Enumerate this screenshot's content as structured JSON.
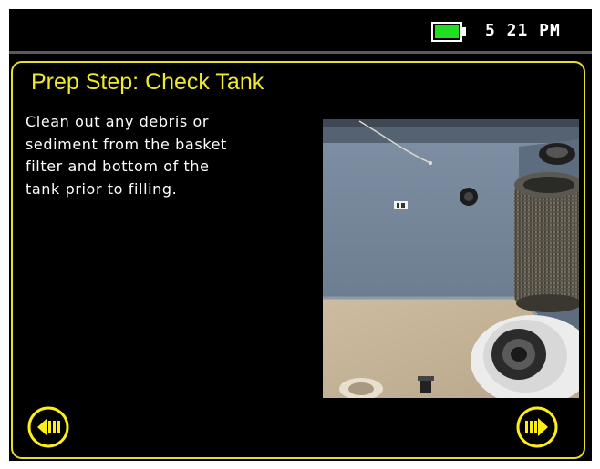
{
  "status": {
    "battery_color": "#22dd22",
    "battery_icon": "battery-icon",
    "time": "5 21 PM"
  },
  "step": {
    "title": "Prep Step: Check Tank",
    "instructions_lines": [
      "Clean out any debris or",
      "sediment from the basket",
      "filter and bottom of the",
      "tank prior to filling."
    ]
  },
  "nav": {
    "prev_icon": "arrow-left-icon",
    "next_icon": "arrow-right-icon"
  },
  "colors": {
    "accent": "#e6e02a",
    "background": "#000000",
    "text": "#ffffff"
  }
}
